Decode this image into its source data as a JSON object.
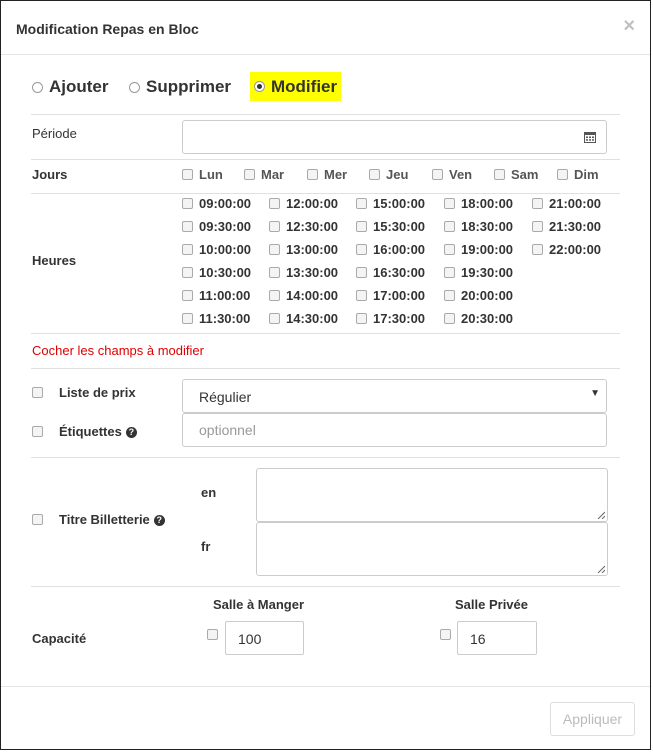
{
  "dialog": {
    "title": "Modification Repas en Bloc",
    "close_glyph": "×"
  },
  "mode": {
    "options": [
      "Ajouter",
      "Supprimer",
      "Modifier"
    ],
    "selected": "Modifier"
  },
  "periode": {
    "label": "Période",
    "value": "",
    "icon": "calendar-icon"
  },
  "jours": {
    "label": "Jours",
    "days": [
      "Lun",
      "Mar",
      "Mer",
      "Jeu",
      "Ven",
      "Sam",
      "Dim"
    ]
  },
  "heures": {
    "label": "Heures",
    "columns": [
      [
        "09:00:00",
        "09:30:00",
        "10:00:00",
        "10:30:00",
        "11:00:00",
        "11:30:00"
      ],
      [
        "12:00:00",
        "12:30:00",
        "13:00:00",
        "13:30:00",
        "14:00:00",
        "14:30:00"
      ],
      [
        "15:00:00",
        "15:30:00",
        "16:00:00",
        "16:30:00",
        "17:00:00",
        "17:30:00"
      ],
      [
        "18:00:00",
        "18:30:00",
        "19:00:00",
        "19:30:00",
        "20:00:00",
        "20:30:00"
      ],
      [
        "21:00:00",
        "21:30:00",
        "22:00:00"
      ]
    ]
  },
  "hint": "Cocher les champs à modifier",
  "liste_prix": {
    "label": "Liste de prix",
    "selected": "Régulier"
  },
  "etiquettes": {
    "label": "Étiquettes",
    "placeholder": "optionnel",
    "help_glyph": "?"
  },
  "titre_billetterie": {
    "label": "Titre Billetterie",
    "help_glyph": "?",
    "lang_en": "en",
    "lang_fr": "fr",
    "en_value": "",
    "fr_value": ""
  },
  "capacite": {
    "label": "Capacité",
    "salle_manger": {
      "label": "Salle à Manger",
      "value": "100"
    },
    "salle_privee": {
      "label": "Salle Privée",
      "value": "16"
    }
  },
  "footer": {
    "apply_label": "Appliquer"
  },
  "colors": {
    "highlight": "#ffff00",
    "hint": "#e00000"
  }
}
